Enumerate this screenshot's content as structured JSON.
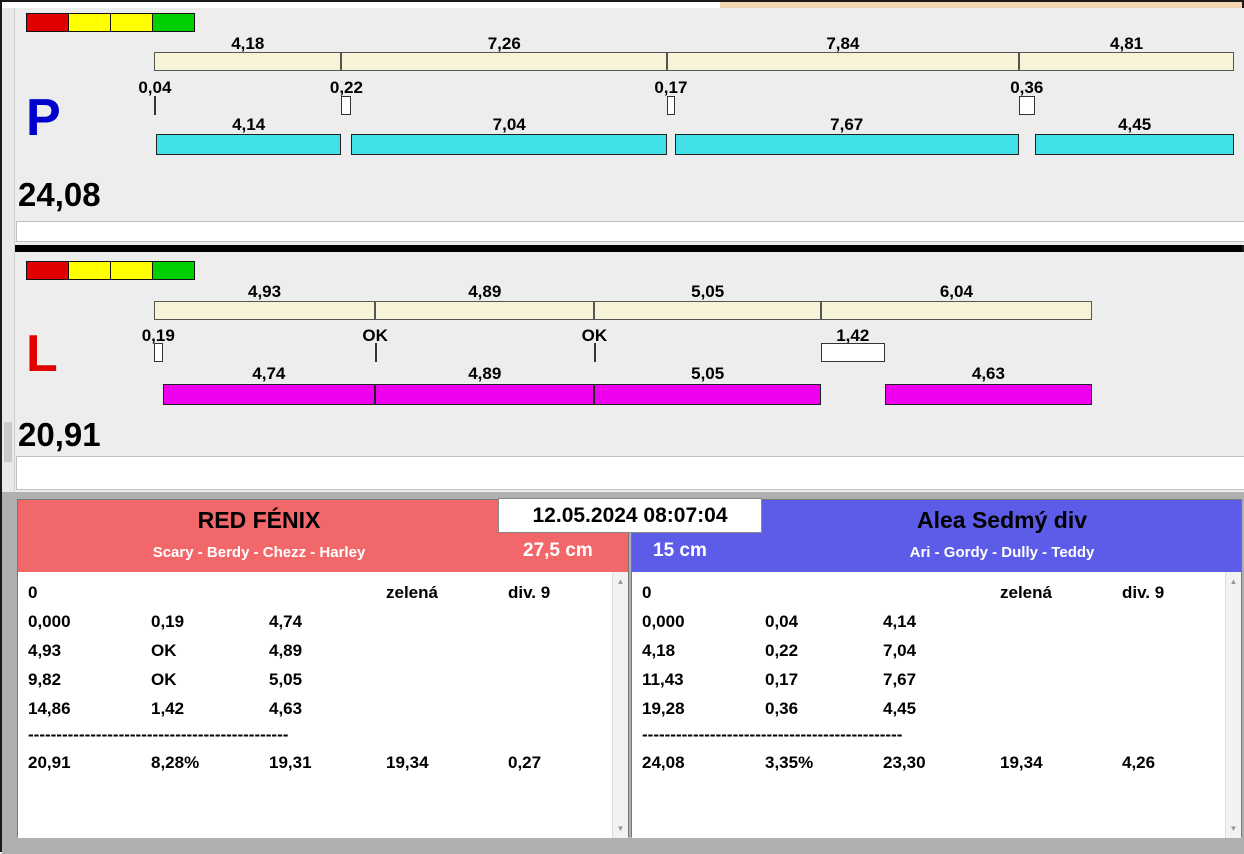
{
  "window": {
    "title_bar_fragment_color": "#f3d6b3"
  },
  "timestamp": "12.05.2024 08:07:04",
  "panels": [
    {
      "id": "P",
      "label": "P",
      "label_color": "#0000cd",
      "total": "24,08",
      "bar_color": "#40e0e6",
      "plan_color": "#f6f3d7",
      "lights": [
        "#e00000",
        "#ffff00",
        "#ffff00",
        "#00cf00"
      ],
      "legs": [
        {
          "split": "4,18",
          "split_v": 4.18,
          "exchange": "0,04",
          "exchange_v": 0.04,
          "run": "4,14",
          "run_v": 4.14
        },
        {
          "split": "7,26",
          "split_v": 7.26,
          "exchange": "0,22",
          "exchange_v": 0.22,
          "run": "7,04",
          "run_v": 7.04
        },
        {
          "split": "7,84",
          "split_v": 7.84,
          "exchange": "0,17",
          "exchange_v": 0.17,
          "run": "7,67",
          "run_v": 7.67
        },
        {
          "split": "4,81",
          "split_v": 4.81,
          "exchange": "0,36",
          "exchange_v": 0.36,
          "run": "4,45",
          "run_v": 4.45
        }
      ]
    },
    {
      "id": "L",
      "label": "L",
      "label_color": "#e00000",
      "total": "20,91",
      "bar_color": "#ee00ee",
      "plan_color": "#f6f3d7",
      "lights": [
        "#e00000",
        "#ffff00",
        "#ffff00",
        "#00cf00"
      ],
      "legs": [
        {
          "split": "4,93",
          "split_v": 4.93,
          "exchange": "0,19",
          "exchange_v": 0.19,
          "run": "4,74",
          "run_v": 4.74
        },
        {
          "split": "4,89",
          "split_v": 4.89,
          "exchange": "OK",
          "exchange_v": 0,
          "run": "4,89",
          "run_v": 4.89
        },
        {
          "split": "5,05",
          "split_v": 5.05,
          "exchange": "OK",
          "exchange_v": 0,
          "run": "5,05",
          "run_v": 5.05
        },
        {
          "split": "6,04",
          "split_v": 6.04,
          "exchange": "1,42",
          "exchange_v": 1.42,
          "run": "4,63",
          "run_v": 4.63
        }
      ]
    }
  ],
  "teams": [
    {
      "name": "RED FÉNIX",
      "members": "Scary - Berdy - Chezz - Harley",
      "category": "27,5 cm",
      "header_color": "#f2686a",
      "rows": [
        [
          "0",
          "",
          "",
          "zelená",
          "div. 9"
        ],
        [
          "0,000",
          "0,19",
          "4,74",
          "",
          ""
        ],
        [
          "4,93",
          "OK",
          "4,89",
          "",
          ""
        ],
        [
          "9,82",
          "OK",
          "5,05",
          "",
          ""
        ],
        [
          "14,86",
          "1,42",
          "4,63",
          "",
          ""
        ]
      ],
      "divider": "----------------------------------------------",
      "total_row": [
        "20,91",
        "8,28%",
        "19,31",
        "19,34",
        "0,27"
      ]
    },
    {
      "name": "Alea Sedmý div",
      "members": "Ari - Gordy - Dully - Teddy",
      "category": "15 cm",
      "header_color": "#5c5ce8",
      "rows": [
        [
          "0",
          "",
          "",
          "zelená",
          "div. 9"
        ],
        [
          "0,000",
          "0,04",
          "4,14",
          "",
          ""
        ],
        [
          "4,18",
          "0,22",
          "7,04",
          "",
          ""
        ],
        [
          "11,43",
          "0,17",
          "7,67",
          "",
          ""
        ],
        [
          "19,28",
          "0,36",
          "4,45",
          "",
          ""
        ]
      ],
      "divider": "----------------------------------------------",
      "total_row": [
        "24,08",
        "3,35%",
        "23,30",
        "19,34",
        "4,26"
      ]
    }
  ]
}
